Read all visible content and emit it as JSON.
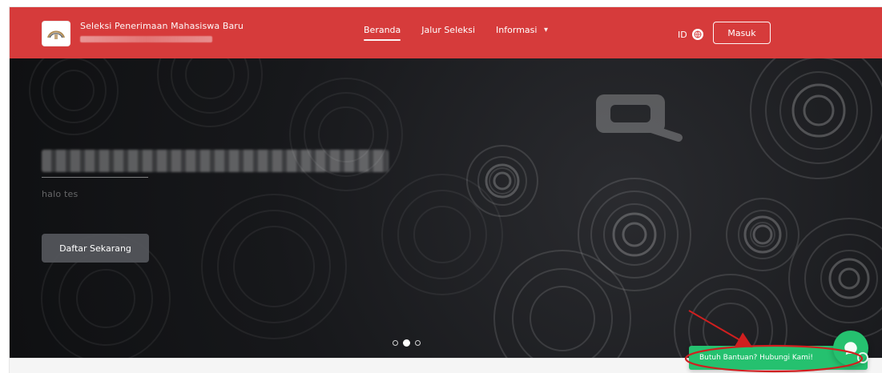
{
  "navbar": {
    "brand_title": "Seleksi Penerimaan Mahasiswa Baru",
    "nav": [
      {
        "label": "Beranda",
        "active": true
      },
      {
        "label": "Jalur Seleksi",
        "active": false
      },
      {
        "label": "Informasi",
        "active": false,
        "has_dropdown": true
      }
    ],
    "lang_code": "ID",
    "login_label": "Masuk",
    "icons": {
      "chevron": "chevron-down-icon",
      "globe": "globe-icon"
    }
  },
  "hero": {
    "subtitle": "halo tes",
    "cta_label": "Daftar Sekarang",
    "carousel": {
      "count": 3,
      "active_index": 1
    }
  },
  "help": {
    "label": "Butuh Bantuan? Hubungi Kami!"
  },
  "colors": {
    "navbar_bg": "#d63b3b",
    "hero_bg": "#17181b",
    "cta_bg": "#55575c",
    "help_green": "#25c16f",
    "annotation_red": "#d01f1f"
  }
}
